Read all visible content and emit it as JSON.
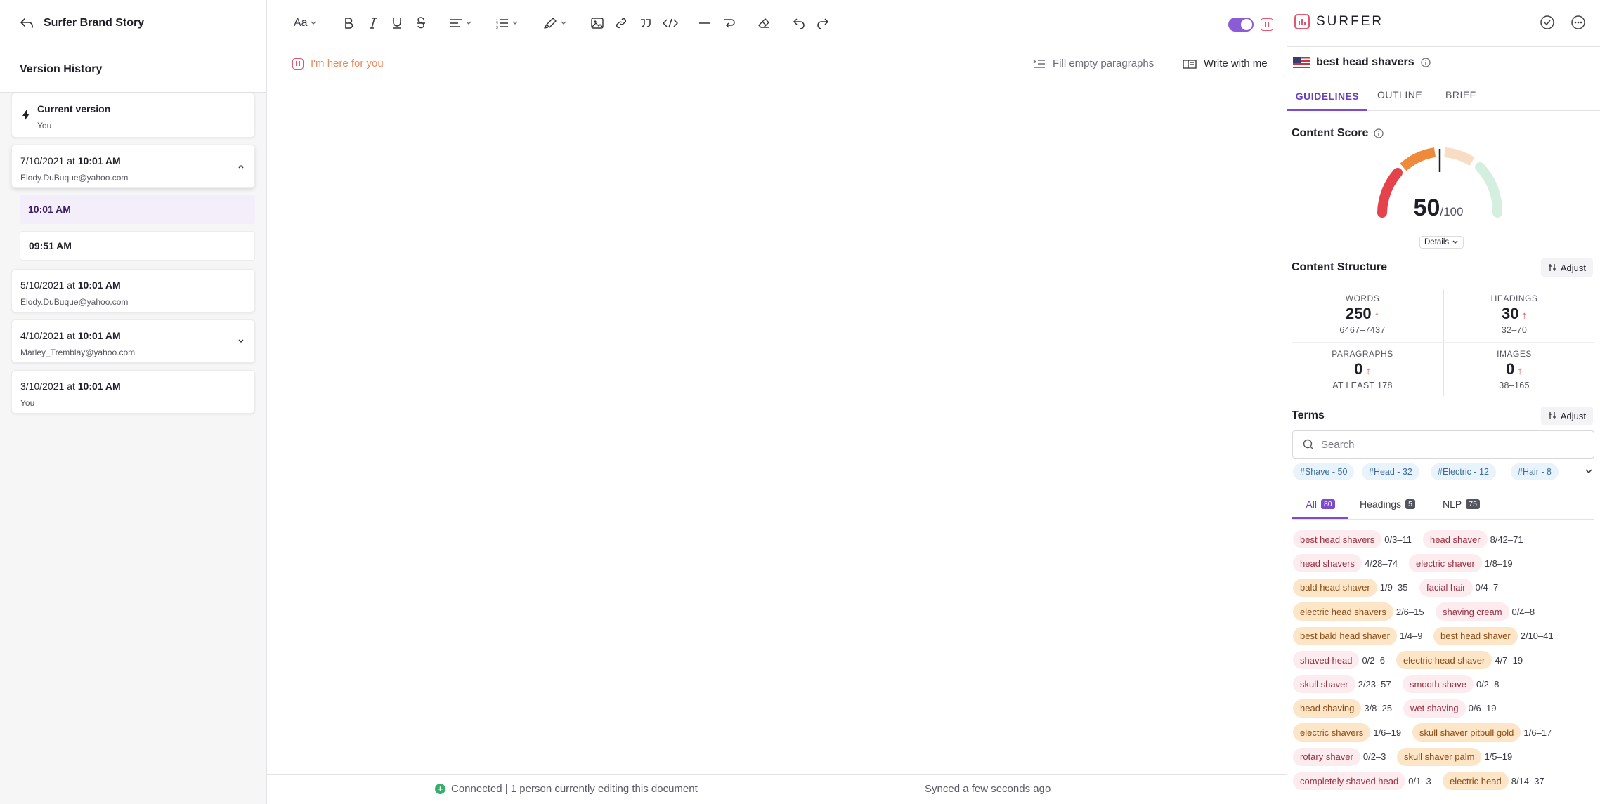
{
  "left": {
    "back_title": "Surfer Brand Story",
    "section_title": "Version History",
    "current": {
      "title": "Current version",
      "author": "You"
    },
    "versions": [
      {
        "date": "7/10/2021 at",
        "time": "10:01 AM",
        "author": "Elody.DuBuque@yahoo.com",
        "expanded": true
      },
      {
        "date": "5/10/2021 at",
        "time": "10:01 AM",
        "author": "Elody.DuBuque@yahoo.com"
      },
      {
        "date": "4/10/2021 at",
        "time": "10:01 AM",
        "author": "Marley_Tremblay@yahoo.com",
        "collapsible": true
      },
      {
        "date": "3/10/2021 at",
        "time": "10:01 AM",
        "author": "You"
      }
    ],
    "subversions": [
      "10:01 AM",
      "09:51 AM"
    ]
  },
  "editor": {
    "font_label": "Aa",
    "assistant_prompt": "I'm here for you",
    "fill_paragraphs": "Fill empty paragraphs",
    "write_with_me": "Write with me",
    "footer": {
      "connected": "Connected | 1 person currently editing this document",
      "synced": "Synced a few seconds ago"
    }
  },
  "right": {
    "brand": "SURFER",
    "keyword": "best head shavers",
    "tabs": [
      "GUIDELINES",
      "OUTLINE",
      "BRIEF"
    ],
    "active_tab": "GUIDELINES",
    "content_score": {
      "label": "Content Score",
      "value": "50",
      "max": "/100",
      "details": "Details"
    },
    "structure": {
      "title": "Content Structure",
      "adjust": "Adjust",
      "words": {
        "label": "WORDS",
        "value": "250",
        "range": "6467–7437"
      },
      "headings": {
        "label": "HEADINGS",
        "value": "30",
        "range": "32–70"
      },
      "paragraphs": {
        "label": "PARAGRAPHS",
        "value": "0",
        "range": "AT LEAST 178"
      },
      "images": {
        "label": "IMAGES",
        "value": "0",
        "range": "38–165"
      }
    },
    "terms": {
      "title": "Terms",
      "adjust": "Adjust",
      "search_placeholder": "Search",
      "tags": [
        "#Shave - 50",
        "#Head - 32",
        "#Electric - 12",
        "#Hair - 8"
      ],
      "filters": [
        {
          "label": "All",
          "count": "80"
        },
        {
          "label": "Headings",
          "count": "5"
        },
        {
          "label": "NLP",
          "count": "75"
        }
      ],
      "list": [
        [
          "best head shavers",
          "0/3–11",
          "red"
        ],
        [
          "head shaver",
          "8/42–71",
          "red"
        ],
        [
          "head shavers",
          "4/28–74",
          "red"
        ],
        [
          "electric shaver",
          "1/8–19",
          "red"
        ],
        [
          "bald head shaver",
          "1/9–35",
          "orange"
        ],
        [
          "facial hair",
          "0/4–7",
          "red"
        ],
        [
          "electric head shavers",
          "2/6–15",
          "orange"
        ],
        [
          "shaving cream",
          "0/4–8",
          "red"
        ],
        [
          "best bald head shaver",
          "1/4–9",
          "orange"
        ],
        [
          "best head shaver",
          "2/10–41",
          "orange"
        ],
        [
          "shaved head",
          "0/2–6",
          "red"
        ],
        [
          "electric head shaver",
          "4/7–19",
          "orange"
        ],
        [
          "skull shaver",
          "2/23–57",
          "red"
        ],
        [
          "smooth shave",
          "0/2–8",
          "red"
        ],
        [
          "head shaving",
          "3/8–25",
          "orange"
        ],
        [
          "wet shaving",
          "0/6–19",
          "red"
        ],
        [
          "electric shavers",
          "1/6–19",
          "orange"
        ],
        [
          "skull shaver pitbull gold",
          "1/6–17",
          "orange"
        ],
        [
          "rotary shaver",
          "0/2–3",
          "red"
        ],
        [
          "skull shaver palm",
          "1/5–19",
          "orange"
        ],
        [
          "completely shaved head",
          "0/1–3",
          "red"
        ],
        [
          "electric head",
          "8/14–37",
          "orange"
        ]
      ]
    }
  }
}
